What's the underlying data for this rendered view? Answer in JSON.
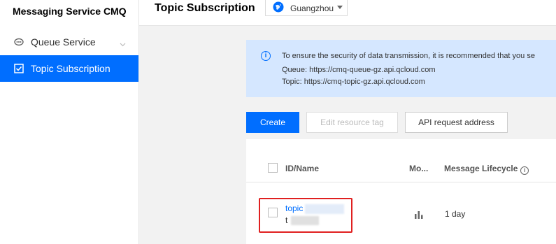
{
  "sidebar": {
    "app_title": "Messaging Service CMQ",
    "items": [
      {
        "label": "Queue Service",
        "icon": "queue-icon"
      },
      {
        "label": "Topic Subscription",
        "icon": "checkbox-icon",
        "active": true
      }
    ]
  },
  "header": {
    "title": "Topic Subscription",
    "region": "Guangzhou"
  },
  "notice": {
    "line1": "To ensure the security of data transmission, it is recommended that you se",
    "line2": "Queue: https://cmq-queue-gz.api.qcloud.com",
    "line3": "Topic: https://cmq-topic-gz.api.qcloud.com"
  },
  "toolbar": {
    "create_label": "Create",
    "edit_tag_label": "Edit resource tag",
    "api_address_label": "API request address"
  },
  "table": {
    "columns": [
      "ID/Name",
      "Mo...",
      "Message Lifecycle"
    ],
    "rows": [
      {
        "id": "topic",
        "name": "t",
        "lifecycle": "1 day"
      }
    ]
  },
  "colors": {
    "accent": "#006eff",
    "highlight": "#e02020",
    "notice_bg": "#d5e7ff"
  }
}
